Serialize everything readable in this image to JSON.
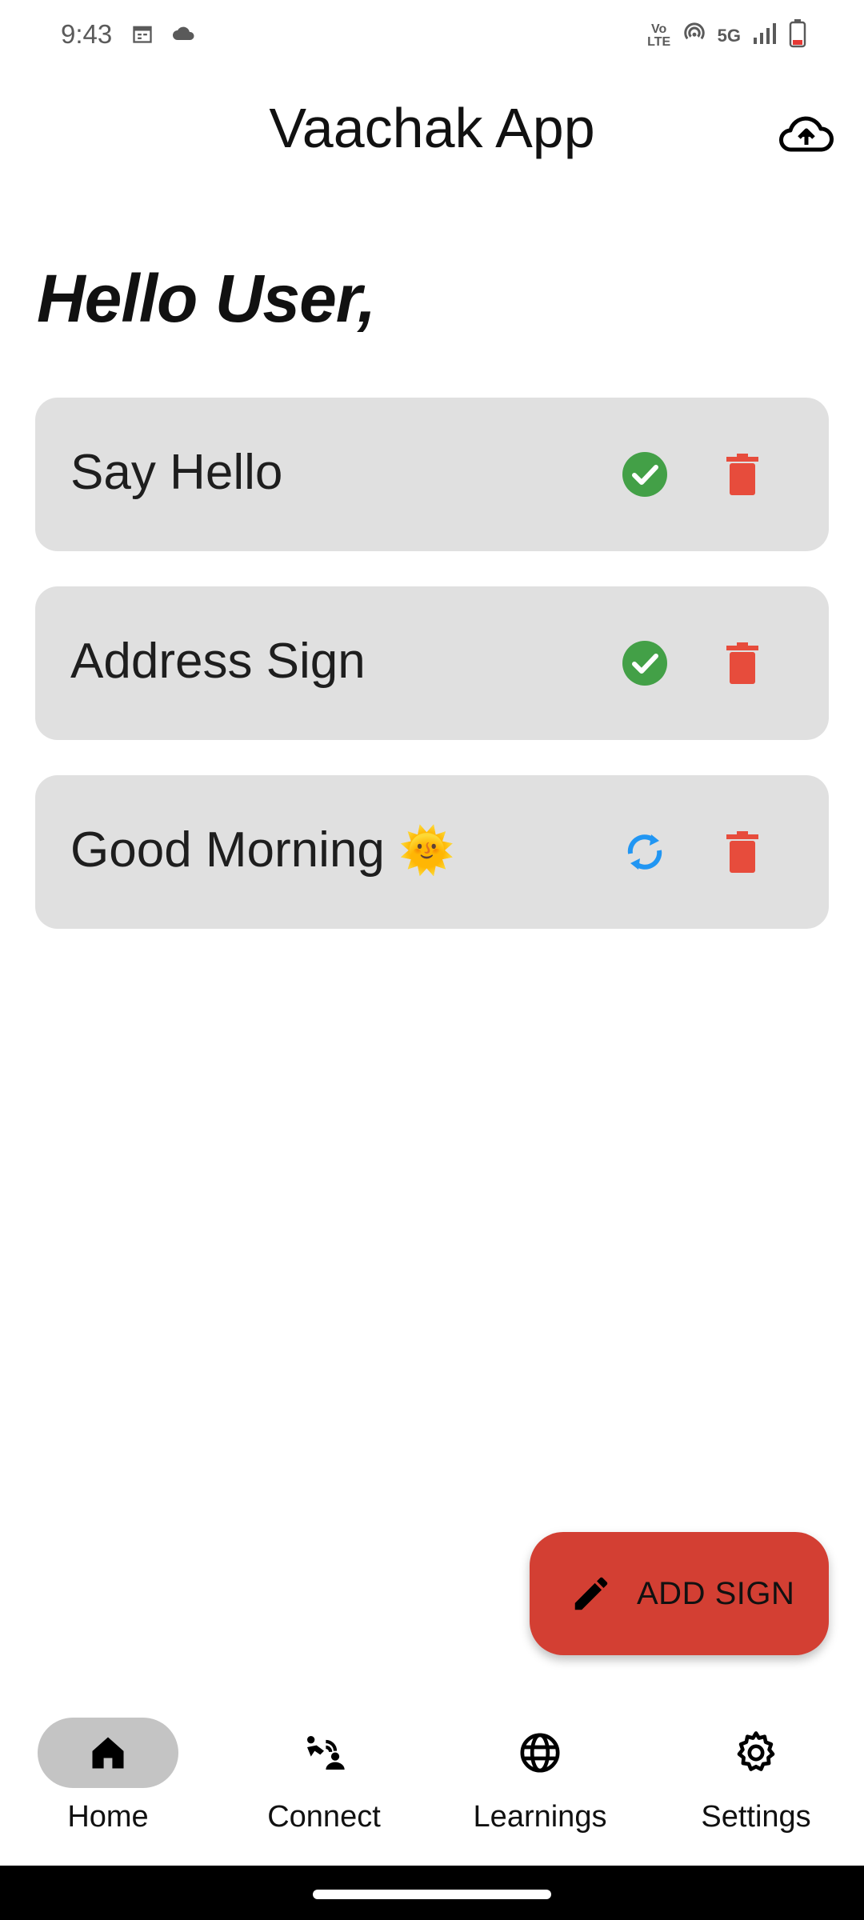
{
  "status_bar": {
    "time": "9:43",
    "network": "5G",
    "volte": "Vo LTE",
    "icons": [
      "calendar-icon",
      "cloud-icon",
      "hotspot-icon",
      "signal-icon",
      "battery-icon"
    ]
  },
  "app_bar": {
    "title": "Vaachak App",
    "action_icon": "cloud-upload-icon"
  },
  "greeting": "Hello User,",
  "signs": [
    {
      "label": "Say Hello",
      "emoji": "",
      "status": "done",
      "status_icon": "check-circle-icon"
    },
    {
      "label": "Address Sign",
      "emoji": "",
      "status": "done",
      "status_icon": "check-circle-icon"
    },
    {
      "label": "Good Morning",
      "emoji": "🌞",
      "status": "syncing",
      "status_icon": "sync-icon"
    }
  ],
  "fab": {
    "label": "ADD SIGN",
    "icon": "pencil-icon"
  },
  "bottom_nav": {
    "items": [
      {
        "label": "Home",
        "icon": "home-icon",
        "active": true
      },
      {
        "label": "Connect",
        "icon": "connect-icon",
        "active": false
      },
      {
        "label": "Learnings",
        "icon": "globe-icon",
        "active": false
      },
      {
        "label": "Settings",
        "icon": "gear-icon",
        "active": false
      }
    ]
  },
  "colors": {
    "card_bg": "#e0e0e0",
    "check_green": "#43a047",
    "delete_red": "#e74c3c",
    "sync_blue": "#2196f3",
    "fab_red": "#d33f33",
    "nav_active_pill": "#c4c4c4"
  }
}
